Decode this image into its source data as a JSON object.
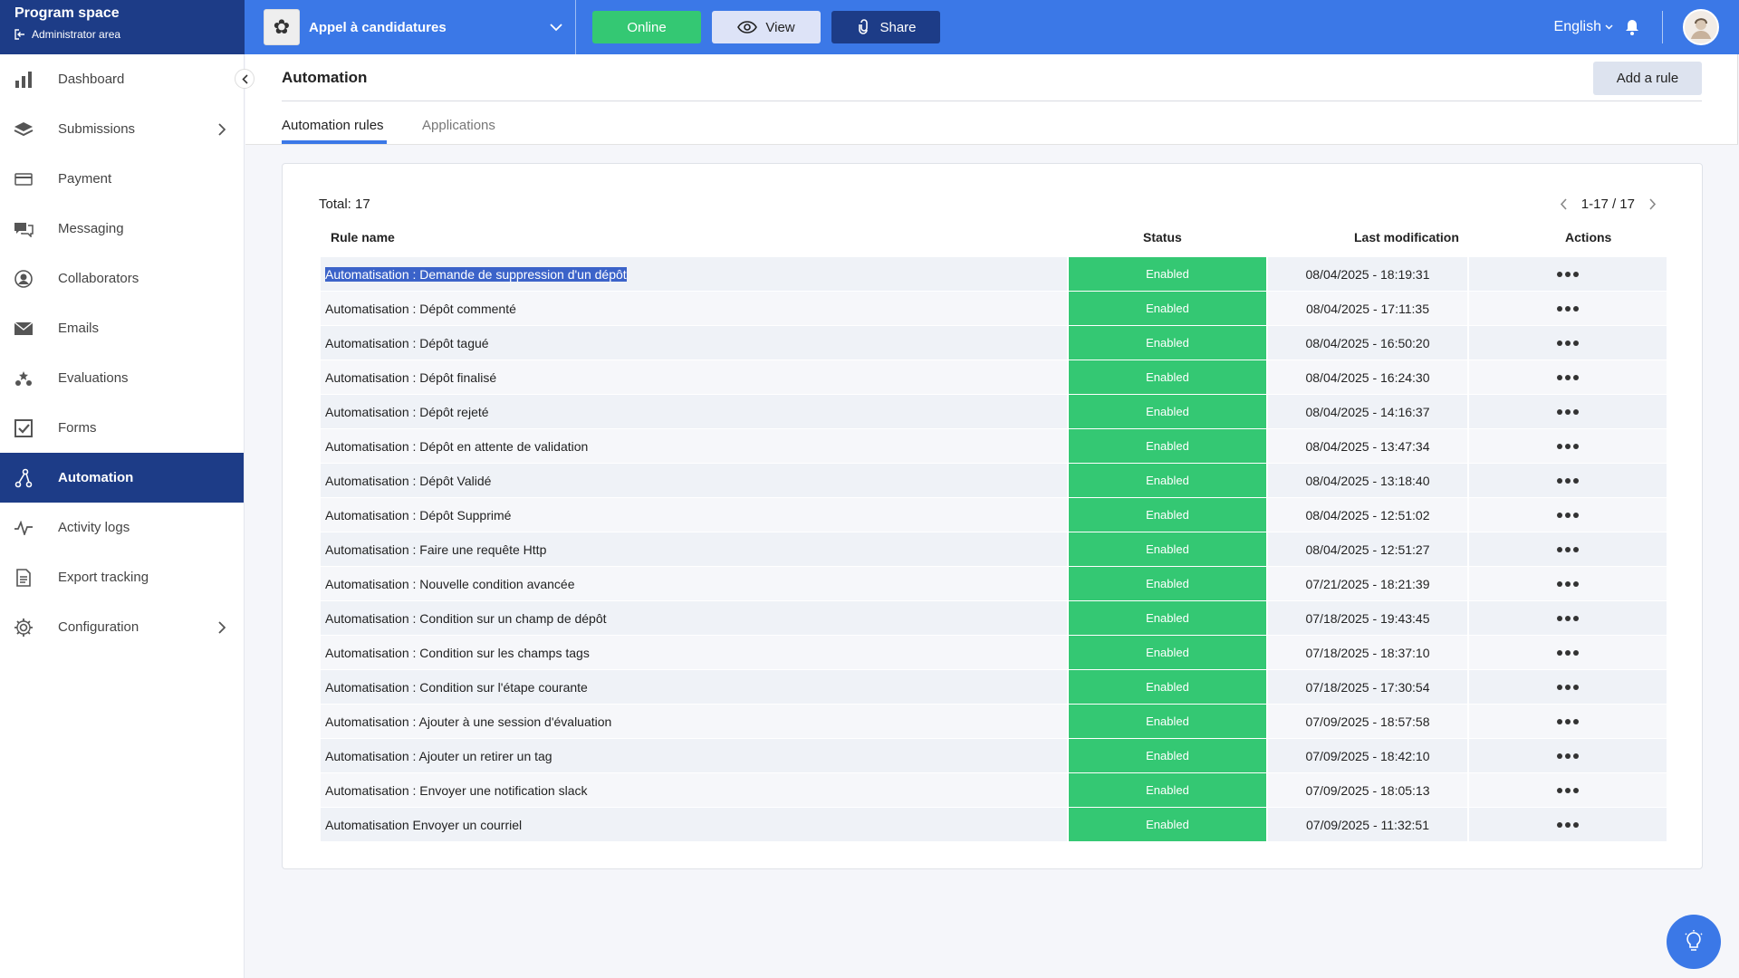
{
  "brand": {
    "title": "Program space",
    "subtitle": "Administrator area"
  },
  "topbar": {
    "program_name": "Appel à candidatures",
    "online_label": "Online",
    "view_label": "View",
    "share_label": "Share",
    "language": "English"
  },
  "sidebar": {
    "items": [
      {
        "label": "Dashboard",
        "icon": "bar-chart-icon"
      },
      {
        "label": "Submissions",
        "icon": "layers-icon"
      },
      {
        "label": "Payment",
        "icon": "credit-card-icon"
      },
      {
        "label": "Messaging",
        "icon": "chat-bubbles-icon"
      },
      {
        "label": "Collaborators",
        "icon": "user-circle-icon"
      },
      {
        "label": "Emails",
        "icon": "envelope-icon"
      },
      {
        "label": "Evaluations",
        "icon": "stars-icon"
      },
      {
        "label": "Forms",
        "icon": "checkbox-icon"
      },
      {
        "label": "Automation",
        "icon": "automation-icon"
      },
      {
        "label": "Activity logs",
        "icon": "pulse-icon"
      },
      {
        "label": "Export tracking",
        "icon": "document-icon"
      },
      {
        "label": "Configuration",
        "icon": "gear-icon"
      }
    ]
  },
  "main": {
    "title": "Automation",
    "add_rule_label": "Add a rule",
    "tabs": [
      {
        "label": "Automation rules"
      },
      {
        "label": "Applications"
      }
    ],
    "total_label": "Total: 17",
    "pagination": "1-17 / 17",
    "columns": {
      "name": "Rule name",
      "status": "Status",
      "modified": "Last modification",
      "actions": "Actions"
    },
    "rows": [
      {
        "name": "Automatisation : Demande de suppression d'un dépôt",
        "status": "Enabled",
        "modified": "08/04/2025 - 18:19:31"
      },
      {
        "name": "Automatisation : Dépôt commenté",
        "status": "Enabled",
        "modified": "08/04/2025 - 17:11:35"
      },
      {
        "name": "Automatisation : Dépôt tagué",
        "status": "Enabled",
        "modified": "08/04/2025 - 16:50:20"
      },
      {
        "name": "Automatisation : Dépôt finalisé",
        "status": "Enabled",
        "modified": "08/04/2025 - 16:24:30"
      },
      {
        "name": "Automatisation : Dépôt rejeté",
        "status": "Enabled",
        "modified": "08/04/2025 - 14:16:37"
      },
      {
        "name": "Automatisation : Dépôt en attente de validation",
        "status": "Enabled",
        "modified": "08/04/2025 - 13:47:34"
      },
      {
        "name": "Automatisation : Dépôt Validé",
        "status": "Enabled",
        "modified": "08/04/2025 - 13:18:40"
      },
      {
        "name": "Automatisation : Dépôt Supprimé",
        "status": "Enabled",
        "modified": "08/04/2025 - 12:51:02"
      },
      {
        "name": "Automatisation : Faire une requête Http",
        "status": "Enabled",
        "modified": "08/04/2025 - 12:51:27"
      },
      {
        "name": "Automatisation : Nouvelle condition avancée",
        "status": "Enabled",
        "modified": "07/21/2025 - 18:21:39"
      },
      {
        "name": "Automatisation : Condition sur un champ de dépôt",
        "status": "Enabled",
        "modified": "07/18/2025 - 19:43:45"
      },
      {
        "name": "Automatisation : Condition sur les champs tags",
        "status": "Enabled",
        "modified": "07/18/2025 - 18:37:10"
      },
      {
        "name": "Automatisation : Condition sur l'étape courante",
        "status": "Enabled",
        "modified": "07/18/2025 - 17:30:54"
      },
      {
        "name": "Automatisation : Ajouter à une session d'évaluation",
        "status": "Enabled",
        "modified": "07/09/2025 - 18:57:58"
      },
      {
        "name": "Automatisation : Ajouter un retirer un tag",
        "status": "Enabled",
        "modified": "07/09/2025 - 18:42:10"
      },
      {
        "name": "Automatisation : Envoyer une notification slack",
        "status": "Enabled",
        "modified": "07/09/2025 - 18:05:13"
      },
      {
        "name": "Automatisation Envoyer un courriel",
        "status": "Enabled",
        "modified": "07/09/2025 - 11:32:51"
      }
    ]
  },
  "colors": {
    "primary": "#3b78e7",
    "navy": "#1d3c87",
    "success": "#34c873"
  }
}
